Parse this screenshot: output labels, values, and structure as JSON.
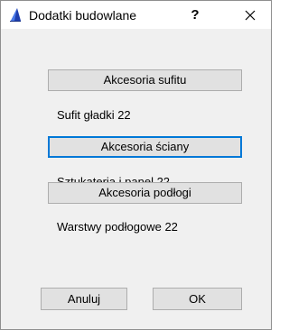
{
  "window": {
    "title": "Dodatki budowlane",
    "help_label": "?",
    "icon": "archicad-icon",
    "close_icon": "close-icon"
  },
  "sections": [
    {
      "button_label": "Akcesoria sufitu",
      "value": "Sufit gładki 22"
    },
    {
      "button_label": "Akcesoria ściany",
      "value": "Sztukateria i panel 22"
    },
    {
      "button_label": "Akcesoria podłogi",
      "value": "Warstwy podłogowe 22"
    }
  ],
  "footer": {
    "cancel_label": "Anuluj",
    "ok_label": "OK"
  },
  "colors": {
    "focus_border": "#0078d7",
    "button_face": "#e1e1e1",
    "dialog_bg": "#f0f0f0"
  }
}
